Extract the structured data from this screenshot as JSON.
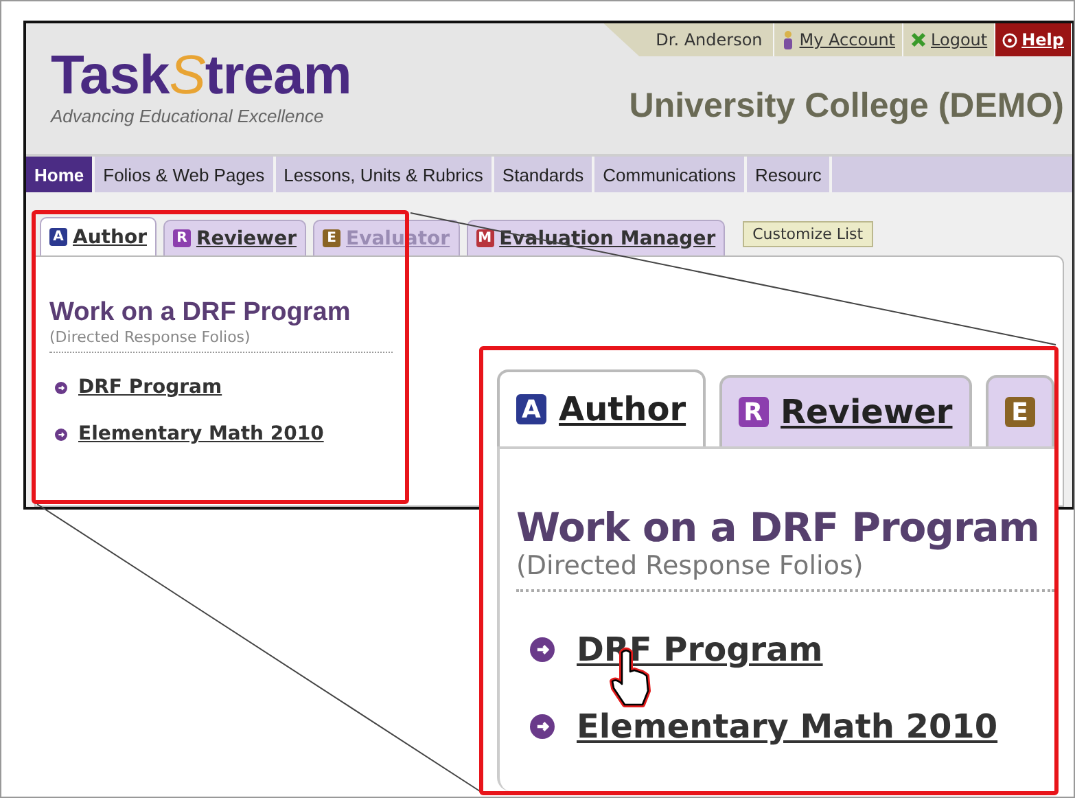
{
  "header": {
    "logo": {
      "parts": [
        {
          "text": "Task",
          "accent": false
        },
        {
          "text": "S",
          "accent": true
        },
        {
          "text": "tream",
          "accent": false
        }
      ],
      "tagline": "Advancing Educational Excellence"
    },
    "user": "Dr. Anderson",
    "links": [
      {
        "kind": "account",
        "label": "My Account"
      },
      {
        "kind": "logout",
        "label": "Logout"
      },
      {
        "kind": "help",
        "label": "Help"
      }
    ],
    "org_title": "University College (DEMO)"
  },
  "nav": [
    {
      "label": "Home",
      "selected": true
    },
    {
      "label": "Folios & Web Pages",
      "selected": false
    },
    {
      "label": "Lessons, Units & Rubrics",
      "selected": false
    },
    {
      "label": "Standards",
      "selected": false
    },
    {
      "label": "Communications",
      "selected": false
    },
    {
      "label": "Resourc",
      "selected": false
    }
  ],
  "tabs": [
    {
      "badge": "A",
      "label": "Author",
      "color": "#2b3990",
      "selected": true,
      "disabled": false
    },
    {
      "badge": "R",
      "label": "Reviewer",
      "color": "#8c3fae",
      "selected": false,
      "disabled": false
    },
    {
      "badge": "E",
      "label": "Evaluator",
      "color": "#8a6424",
      "selected": false,
      "disabled": true
    },
    {
      "badge": "M",
      "label": "Evaluation Manager",
      "color": "#b8343c",
      "selected": false,
      "disabled": false
    }
  ],
  "customize_button": "Customize List",
  "content": {
    "heading": "Work on a DRF Program",
    "subtitle": "(Directed Response Folios)",
    "programs": [
      "DRF Program",
      "Elementary Math 2010"
    ]
  },
  "zoom_inset": {
    "tabs": [
      {
        "badge": "A",
        "label": "Author",
        "color": "#2b3990",
        "selected": true
      },
      {
        "badge": "R",
        "label": "Reviewer",
        "color": "#8c3fae",
        "selected": false
      },
      {
        "badge": "E",
        "color": "#8a6424",
        "selected": false
      }
    ],
    "heading": "Work on a DRF Program",
    "subtitle": "(Directed Response Folios)",
    "programs": [
      "DRF Program",
      "Elementary Math 2010"
    ]
  }
}
